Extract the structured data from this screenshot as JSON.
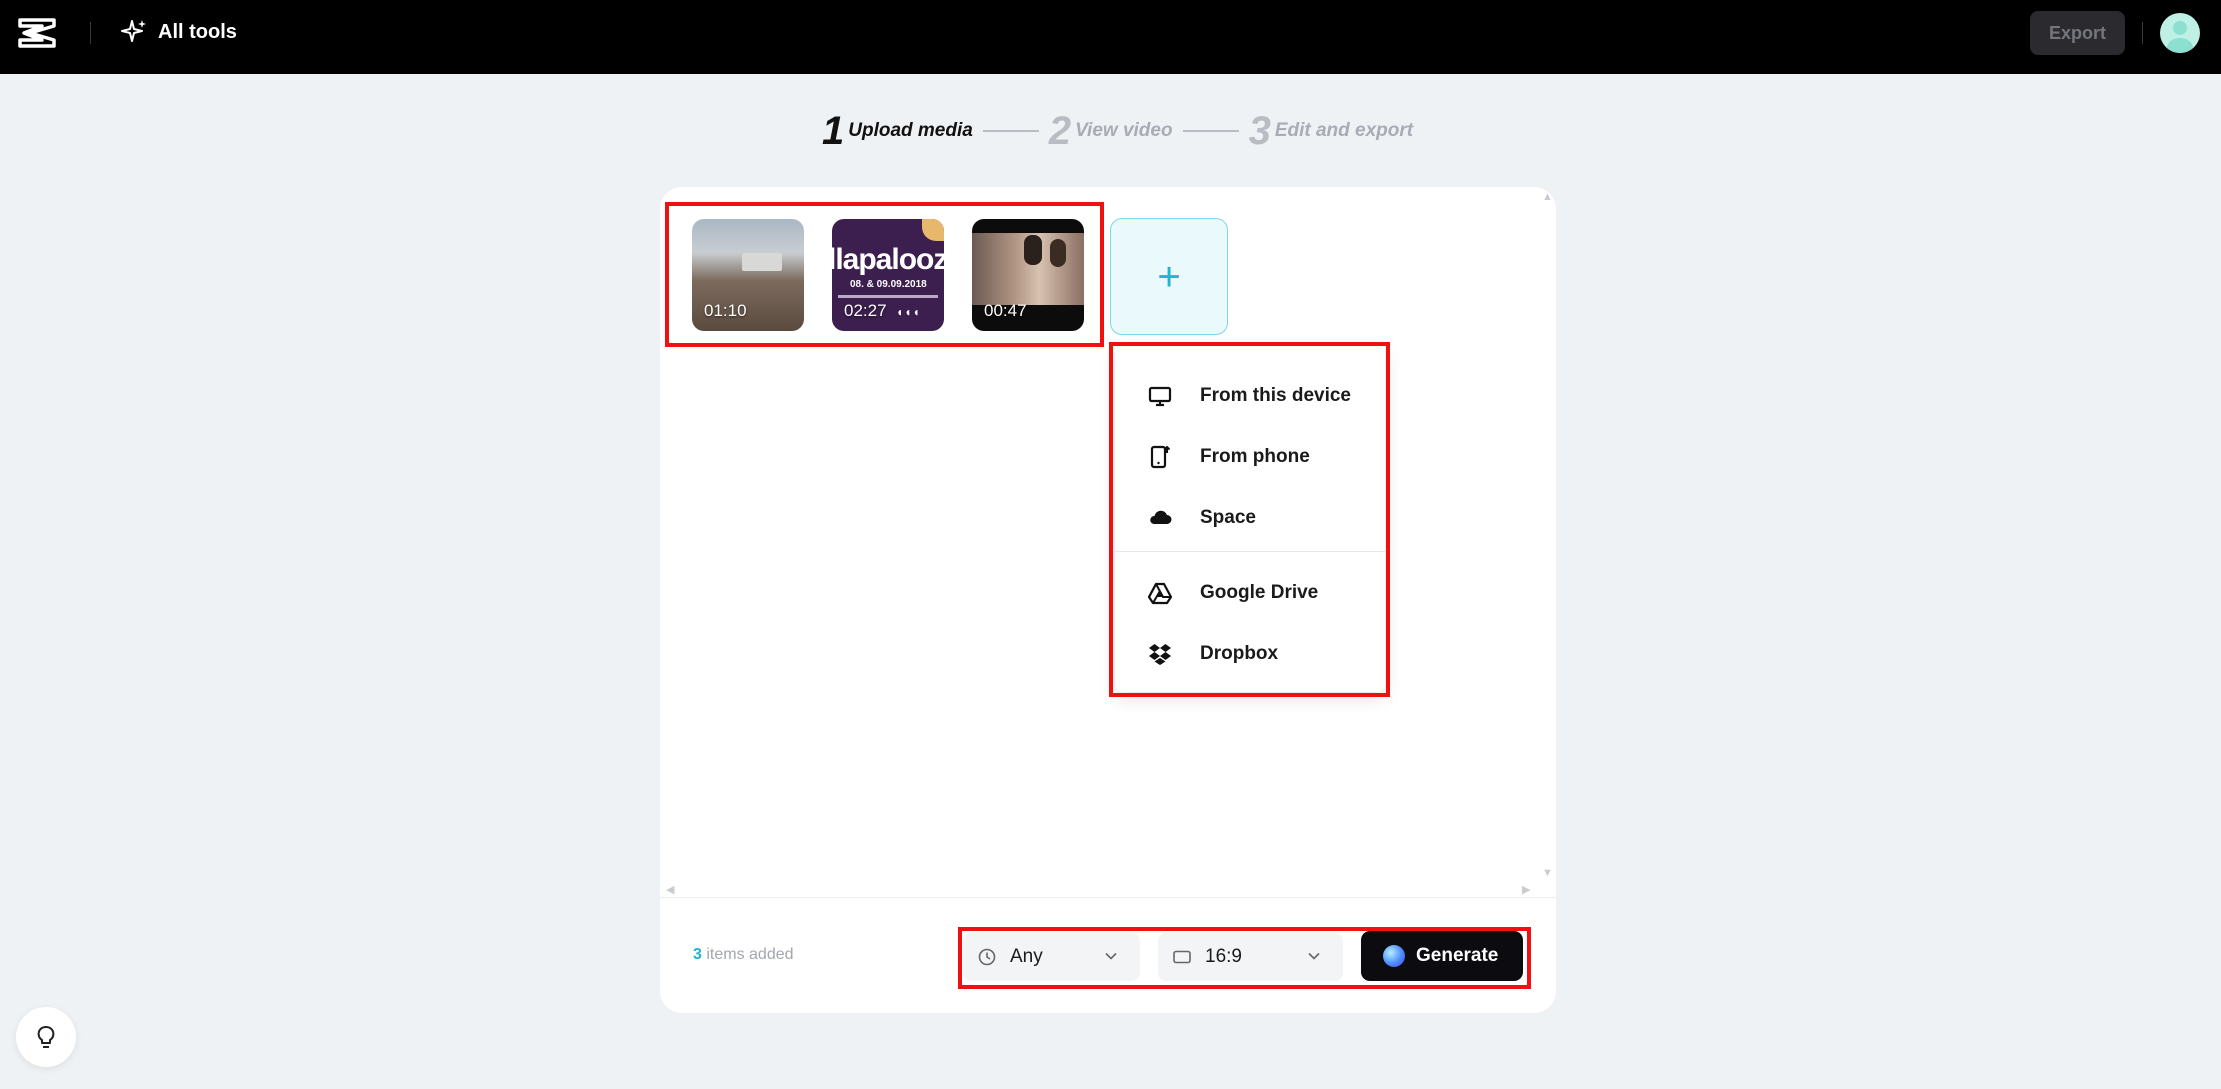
{
  "topbar": {
    "all_tools_label": "All tools",
    "export_label": "Export"
  },
  "steps": [
    {
      "number": "1",
      "label": "Upload media",
      "state": "active"
    },
    {
      "number": "2",
      "label": "View video",
      "state": "inactive"
    },
    {
      "number": "3",
      "label": "Edit and export",
      "state": "inactive"
    }
  ],
  "media": [
    {
      "duration": "01:10",
      "thumbnail": "stadium crowd"
    },
    {
      "duration": "02:27",
      "thumbnail": "festival poster",
      "poster_text": "llapalooz",
      "poster_dates": "08. & 09.09.2018"
    },
    {
      "duration": "00:47",
      "thumbnail": "people at party"
    }
  ],
  "add_button": {
    "icon": "plus-icon",
    "label": "+"
  },
  "source_menu": {
    "items": [
      {
        "label": "From this device",
        "icon": "monitor-icon"
      },
      {
        "label": "From phone",
        "icon": "phone-upload-icon"
      },
      {
        "label": "Space",
        "icon": "cloud-icon"
      },
      {
        "label": "Google Drive",
        "icon": "google-drive-icon"
      },
      {
        "label": "Dropbox",
        "icon": "dropbox-icon"
      }
    ]
  },
  "footer": {
    "items_count": "3",
    "items_added_text": "items added",
    "duration_select": {
      "value": "Any",
      "icon": "clock-icon"
    },
    "ratio_select": {
      "value": "16:9",
      "icon": "aspect-ratio-icon"
    },
    "generate_label": "Generate"
  },
  "colors": {
    "accent": "#1fb4cf",
    "topbar": "#000000",
    "background": "#eff2f5",
    "annotation": "#f01010"
  }
}
